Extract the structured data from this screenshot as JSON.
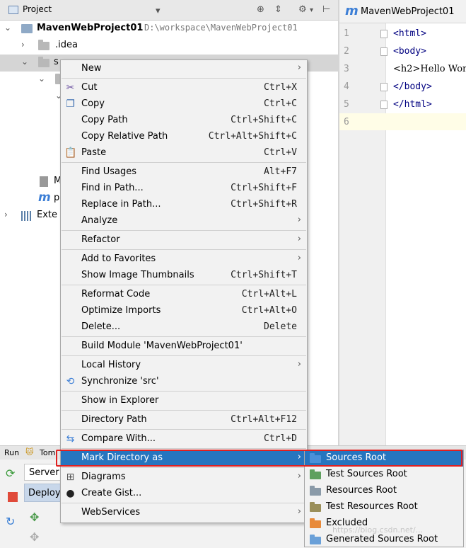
{
  "project_panel": {
    "title": "Project",
    "tree": [
      {
        "label": "MavenWebProject01",
        "path": "D:\\workspace\\MavenWebProject01"
      },
      {
        "label": ".idea"
      },
      {
        "label": "s"
      },
      {
        "label": "M"
      },
      {
        "label": "p"
      },
      {
        "label": "Exte"
      }
    ]
  },
  "editor": {
    "tab_label": "MavenWebProject01",
    "line_numbers": [
      "1",
      "2",
      "3",
      "4",
      "5",
      "6"
    ],
    "lines": [
      "<html>",
      "<body>",
      "<h2>Hello Wor",
      "</body>",
      "</html>",
      ""
    ]
  },
  "run_panel": {
    "tab_run": "Run",
    "tab_tomcat": "Tom",
    "server_label": "Server",
    "deploy_label": "Deploy"
  },
  "context_menu": {
    "items": [
      {
        "label": "New",
        "shortcut": "",
        "submenu": true
      },
      {
        "label": "Cut",
        "shortcut": "Ctrl+X"
      },
      {
        "label": "Copy",
        "shortcut": "Ctrl+C"
      },
      {
        "label": "Copy Path",
        "shortcut": "Ctrl+Shift+C"
      },
      {
        "label": "Copy Relative Path",
        "shortcut": "Ctrl+Alt+Shift+C"
      },
      {
        "label": "Paste",
        "shortcut": "Ctrl+V"
      },
      {
        "label": "Find Usages",
        "shortcut": "Alt+F7"
      },
      {
        "label": "Find in Path...",
        "shortcut": "Ctrl+Shift+F"
      },
      {
        "label": "Replace in Path...",
        "shortcut": "Ctrl+Shift+R"
      },
      {
        "label": "Analyze",
        "shortcut": "",
        "submenu": true
      },
      {
        "label": "Refactor",
        "shortcut": "",
        "submenu": true
      },
      {
        "label": "Add to Favorites",
        "shortcut": "",
        "submenu": true
      },
      {
        "label": "Show Image Thumbnails",
        "shortcut": "Ctrl+Shift+T"
      },
      {
        "label": "Reformat Code",
        "shortcut": "Ctrl+Alt+L"
      },
      {
        "label": "Optimize Imports",
        "shortcut": "Ctrl+Alt+O"
      },
      {
        "label": "Delete...",
        "shortcut": "Delete"
      },
      {
        "label": "Build Module 'MavenWebProject01'",
        "shortcut": ""
      },
      {
        "label": "Local History",
        "shortcut": "",
        "submenu": true
      },
      {
        "label": "Synchronize 'src'",
        "shortcut": ""
      },
      {
        "label": "Show in Explorer",
        "shortcut": ""
      },
      {
        "label": "Directory Path",
        "shortcut": "Ctrl+Alt+F12"
      },
      {
        "label": "Compare With...",
        "shortcut": "Ctrl+D"
      },
      {
        "label": "Mark Directory as",
        "shortcut": "",
        "submenu": true,
        "selected": true
      },
      {
        "label": "Diagrams",
        "shortcut": "",
        "submenu": true
      },
      {
        "label": "Create Gist...",
        "shortcut": ""
      },
      {
        "label": "WebServices",
        "shortcut": "",
        "submenu": true
      }
    ]
  },
  "mark_submenu": {
    "items": [
      {
        "label": "Sources Root",
        "selected": true,
        "color": "#4a90d9"
      },
      {
        "label": "Test Sources Root",
        "color": "#5fa05f"
      },
      {
        "label": "Resources Root",
        "color": "#8a9aa8"
      },
      {
        "label": "Test Resources Root",
        "color": "#9a8f5a"
      },
      {
        "label": "Excluded",
        "color": "#e88a3a"
      },
      {
        "label": "Generated Sources Root",
        "color": "#6aa0d8"
      }
    ]
  },
  "watermark": "https://blog.csdn.net/..."
}
